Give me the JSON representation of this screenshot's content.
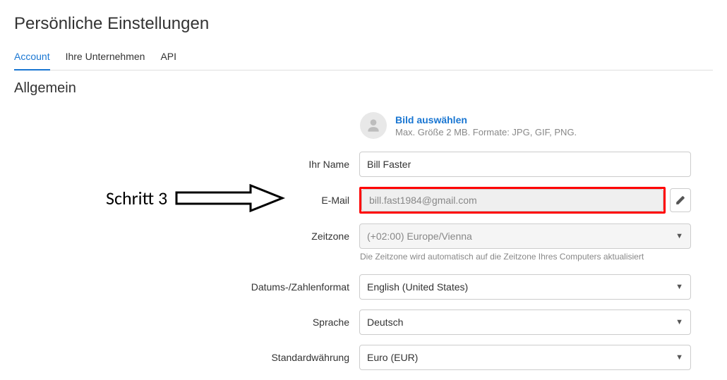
{
  "page_title": "Persönliche Einstellungen",
  "tabs": {
    "account": "Account",
    "companies": "Ihre Unternehmen",
    "api": "API"
  },
  "section_title": "Allgemein",
  "avatar": {
    "pick_label": "Bild auswählen",
    "hint": "Max. Größe 2 MB. Formate: JPG, GIF, PNG."
  },
  "labels": {
    "name": "Ihr Name",
    "email": "E-Mail",
    "timezone": "Zeitzone",
    "date_format": "Datums-/Zahlenformat",
    "language": "Sprache",
    "currency": "Standardwährung"
  },
  "values": {
    "name": "Bill Faster",
    "email": "bill.fast1984@gmail.com",
    "timezone": "(+02:00) Europe/Vienna",
    "date_format": "English (United States)",
    "language": "Deutsch",
    "currency": "Euro (EUR)"
  },
  "timezone_note": "Die Zeitzone wird automatisch auf die Zeitzone Ihres Computers aktualisiert",
  "annotation": "Schritt 3"
}
